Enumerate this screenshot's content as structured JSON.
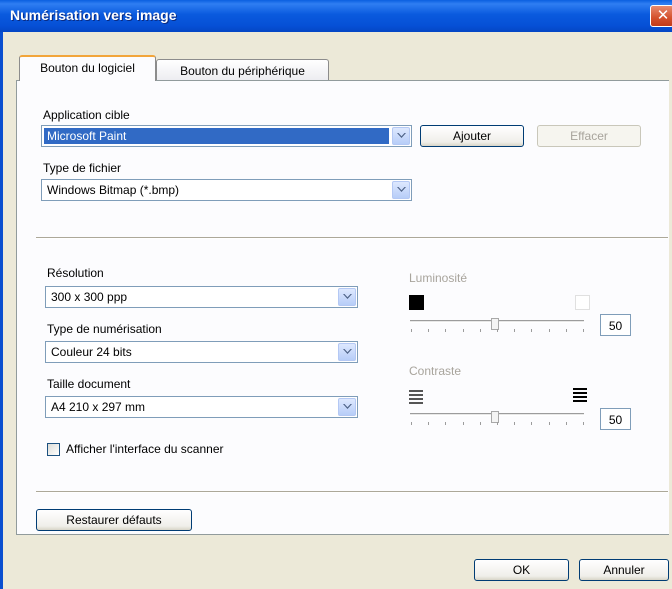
{
  "window": {
    "title": "Numérisation vers image",
    "close_glyph": "✕"
  },
  "tabs": [
    {
      "label": "Bouton du logiciel",
      "active": true
    },
    {
      "label": "Bouton du périphérique",
      "active": false
    }
  ],
  "target_app": {
    "label": "Application cible",
    "value": "Microsoft Paint",
    "add_button": "Ajouter",
    "delete_button": "Effacer"
  },
  "file_type": {
    "label": "Type de fichier",
    "value": "Windows Bitmap (*.bmp)"
  },
  "resolution": {
    "label": "Résolution",
    "value": "300 x 300 ppp"
  },
  "scan_type": {
    "label": "Type de numérisation",
    "value": "Couleur 24 bits"
  },
  "doc_size": {
    "label": "Taille document",
    "value": "A4 210 x 297 mm"
  },
  "brightness": {
    "label": "Luminosité",
    "value": "50",
    "level": 0.5,
    "enabled": false
  },
  "contrast": {
    "label": "Contraste",
    "value": "50",
    "level": 0.5,
    "enabled": false
  },
  "show_scanner_ui": {
    "label": "Afficher l'interface du scanner",
    "checked": false
  },
  "buttons": {
    "restore": "Restaurer défauts",
    "ok": "OK",
    "cancel": "Annuler"
  },
  "colors": {
    "titlebar": "#0a5ade",
    "selection": "#316ac5",
    "tab_highlight": "#f2a53a",
    "disabled_text": "#a8a49c"
  },
  "icons": [
    "close-icon",
    "chevron-down-icon",
    "brightness-low-icon",
    "brightness-high-icon",
    "contrast-low-icon",
    "contrast-high-icon"
  ]
}
